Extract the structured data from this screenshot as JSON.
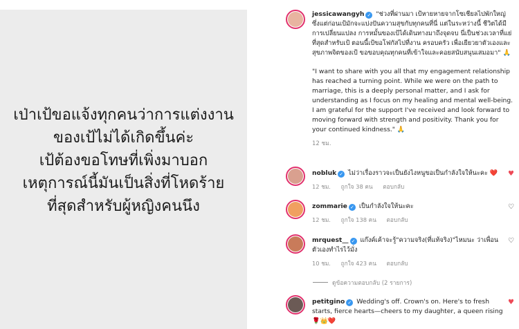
{
  "overlay": {
    "lines": [
      "เป่าเป้ขอแจ้งทุกคนว่าการแต่งงาน",
      "ของเป้ไม่ได้เกิดขึ้นค่ะ",
      "เป้ต้องขอโทษที่เพิ่งมาบอก",
      "เหตุการณ์นี้มันเป็นสิ่งที่โหดร้าย",
      "ที่สุดสำหรับผู้หญิงคนนึง"
    ]
  },
  "post": {
    "username": "jessicawangyh",
    "caption_th": "\"ช่วงที่ผ่านมา เป้หายหายจากโซเชียลไปพักใหญ่ ซึ่งแต่ก่อนเป้มักจะแบ่งปันความสุขกับทุกคนที่นี่ แต่ในระหว่างนี้ ชีวิตได้มีการเปลี่ยนแปลง การหมั้นของเป้ได้เดินทางมาถึงจุดจบ นี่เป็นช่วงเวลาที่แย่ที่สุดสำหรับเป้ ตอนนี้เป้ขอโฟกัสไปที่งาน ครอบครัว เพื่อเยียวยาตัวเองและสุขภาพจิตของเป้ ขอขอบคุณทุกคนที่เข้าใจและคอยสนับสนุนเสมอมา\" 🙏",
    "caption_en": "\"I want to share with you all that my engagement relationship has reached a turning point. While we were on the path to marriage, this is a deeply personal matter, and I ask for understanding as I focus on my healing and mental well-being. I am grateful for the support I've received and look forward to moving forward with strength and positivity. Thank you for your continued kindness.\" 🙏",
    "time": "12 ชม.",
    "avatar_color": "#e8b4a0"
  },
  "comments": [
    {
      "username": "nobluk",
      "verified": true,
      "text": "ไม่ว่าเรื่องราวจะเป็นยังไงหนูขอเป็นกำลังใจให้นะคะ ❤️",
      "time": "12 ชม.",
      "likes": "ถูกใจ 38 คน",
      "reply": "ตอบกลับ",
      "liked": true,
      "avatar_color": "#d9a08f"
    },
    {
      "username": "zommarie",
      "verified": true,
      "text": "เป็นกำลังใจให้นะคะ",
      "time": "12 ชม.",
      "likes": "ถูกใจ 138 คน",
      "reply": "ตอบกลับ",
      "liked": false,
      "avatar_color": "#f0a060"
    },
    {
      "username": "mrquest__",
      "verified": true,
      "text": "แก๊งค์เค้าจะรู้\"ความจริง(ที่แท้จริง)\"ไหมนะ ว่าเพื่อนตัวเองทำไรไว้มั่ง",
      "time": "10 ชม.",
      "likes": "ถูกใจ 423 คน",
      "reply": "ตอบกลับ",
      "liked": false,
      "avatar_color": "#c97b5a"
    },
    {
      "username": "petitgino",
      "verified": true,
      "text": "Wedding's off. Crown's on. Here's to fresh starts, fierce hearts—cheers to my daughter, a queen rising 🌹👑❤️",
      "time": "",
      "likes": "",
      "reply": "",
      "liked": true,
      "avatar_color": "#6b5a55"
    }
  ],
  "view_replies": "ดูข้อความตอบกลับ (2 รายการ)",
  "colors": {
    "accent": "#3897f0",
    "heart": "#ed4956",
    "muted": "#8e8e8e",
    "ring": "#e1306c"
  }
}
